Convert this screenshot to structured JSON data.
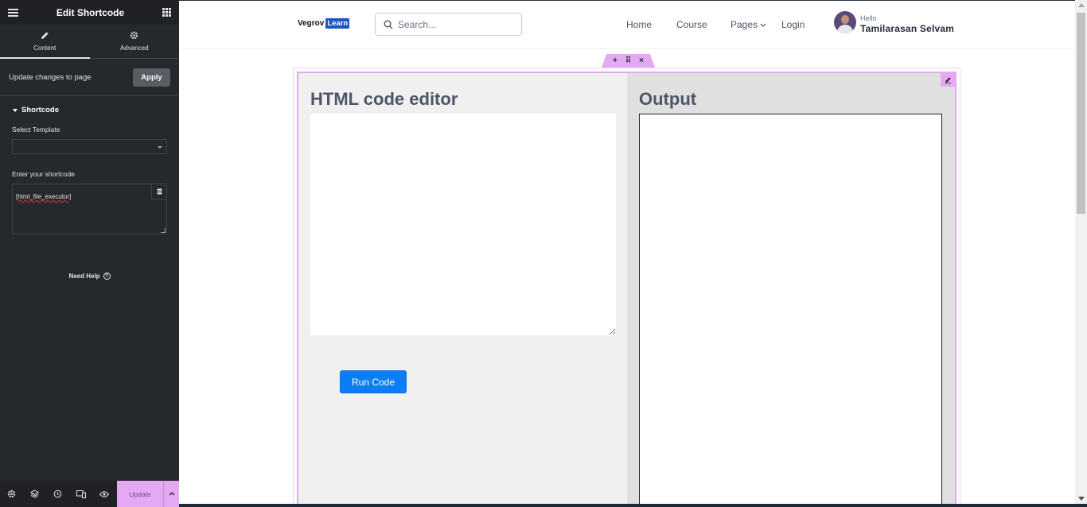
{
  "panel": {
    "title": "Edit Shortcode",
    "tabs": [
      {
        "label": "Content",
        "icon": "pencil-icon",
        "active": true
      },
      {
        "label": "Advanced",
        "icon": "gear-icon",
        "active": false
      }
    ],
    "apply_row": {
      "label": "Update changes to page",
      "button": "Apply"
    },
    "section_title": "Shortcode",
    "select_template_label": "Select Template",
    "select_template_value": "",
    "shortcode_label": "Enter your shortcode",
    "shortcode_value": "[html_file_executor]",
    "need_help": "Need Help",
    "footer": {
      "update_label": "Update"
    }
  },
  "site": {
    "logo_text": "Vegrov",
    "logo_badge": "Learn",
    "search_placeholder": "Search...",
    "nav": [
      "Home",
      "Course",
      "Pages",
      "Login"
    ],
    "greeting": "Hello",
    "username": "Tamilarasan Selvam"
  },
  "content": {
    "editor_heading": "HTML code editor",
    "output_heading": "Output",
    "run_button": "Run Code"
  },
  "colors": {
    "panel_bg": "#26292c",
    "accent_pink": "#e5a8f2",
    "run_button": "#0d7df5",
    "logo_badge": "#1a56c4"
  }
}
